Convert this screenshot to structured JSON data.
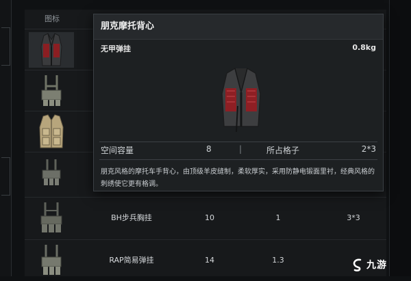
{
  "table": {
    "icon_header": "图标",
    "rows": [
      {
        "icon": "punk-moto-vest-icon",
        "name": "",
        "capacity": "",
        "slots": "",
        "grid": ""
      },
      {
        "icon": "chest-rig-harness-icon",
        "name": "",
        "capacity": "",
        "slots": "",
        "grid": ""
      },
      {
        "icon": "tan-tactical-vest-icon",
        "name": "",
        "capacity": "",
        "slots": "",
        "grid": ""
      },
      {
        "icon": "small-chest-rig-icon",
        "name": "",
        "capacity": "",
        "slots": "",
        "grid": ""
      },
      {
        "icon": "bh-infantry-chest-rig-icon",
        "name": "BH步兵胸挂",
        "capacity": "10",
        "slots": "1",
        "grid": "3*3"
      },
      {
        "icon": "rap-simple-rig-icon",
        "name": "RAP简易弹挂",
        "capacity": "14",
        "slots": "1.3",
        "grid": ""
      }
    ]
  },
  "tooltip": {
    "title": "朋克摩托背心",
    "subtitle": "无甲弹挂",
    "weight": "0.8kg",
    "image_icon": "punk-moto-vest-icon",
    "space_label": "空间容量",
    "space_value": "8",
    "divider": "|",
    "cells_label": "所占格子",
    "cells_value": "2*3",
    "description": "朋克风格的摩托车手背心，由顶级羊皮缝制，柔软厚实，采用防静电锻面里衬，经典风格的刺绣使它更有格调。"
  },
  "watermark": {
    "logo_icon": "jiuyou-logo-icon",
    "text": "九游"
  }
}
